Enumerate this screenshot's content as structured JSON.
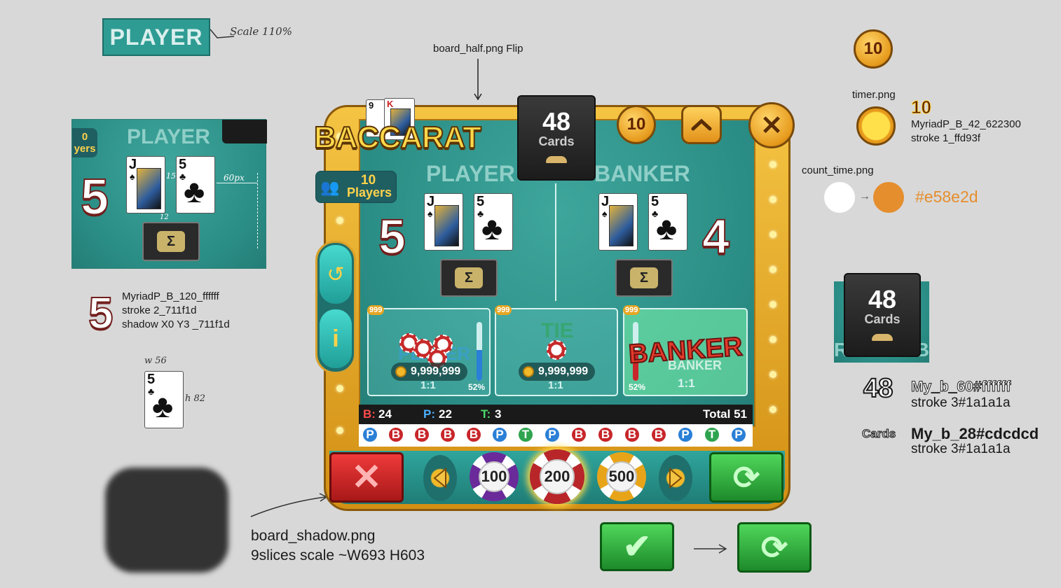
{
  "colors": {
    "felt": "#2a8d85",
    "gold": "#e5a623",
    "red": "#c8262a",
    "green": "#2ea44f",
    "count_orange": "#e58e2d",
    "panel_dark": "#1a1a1a"
  },
  "annotations": {
    "player_tag": "PLAYER",
    "scale_note": "Scale 110%",
    "board_half": "board_half.png  Flip",
    "timer_png": "timer.png",
    "timer_value": "10",
    "timer_font_line1": "MyriadP_B_42_622300",
    "timer_font_line2": "stroke 1_ffd93f",
    "count_time": "count_time.png",
    "count_color": "#e58e2d",
    "score_font_line1": "MyriadP_B_120_ffffff",
    "score_font_line2": "stroke 2_711f1d",
    "score_font_line3": "shadow X0 Y3 _711f1d",
    "w_note": "w 56",
    "h_note": "h 82",
    "shadow_line1": "board_shadow.png",
    "shadow_line2": "9slices scale ~W693 H603",
    "cards_num_font": "My_b_60#ffffff",
    "cards_num_stroke": "stroke 3#1a1a1a",
    "cards_lbl_font": "My_b_28#cdcdcd",
    "cards_lbl_stroke": "stroke 3#1a1a1a",
    "demo_num": "48",
    "demo_lbl": "Cards",
    "gap_15": "15",
    "gap_60": "60px",
    "gap_12": "12"
  },
  "zoom_panel": {
    "title": "PLAYER",
    "players_num": "0",
    "players_lbl": "yers",
    "score": "5",
    "card1": "J",
    "card2": "5"
  },
  "sample_score": "5",
  "sample_card": "5",
  "game": {
    "logo": "BACCARAT",
    "players_count": "10",
    "players_label": "Players",
    "cards_count": "48",
    "cards_label": "Cards",
    "timer": "10",
    "player_label": "PLAYER",
    "banker_label": "BANKER",
    "player_score": "5",
    "banker_score": "4",
    "player_cards": [
      "J",
      "5"
    ],
    "banker_cards": [
      "J",
      "5"
    ],
    "bets": [
      {
        "name": "PLAYER",
        "amount": "9,999,999",
        "odds": "1:1",
        "percent": "52%",
        "max": "999"
      },
      {
        "name": "TIE",
        "amount": "9,999,999",
        "odds": "1:1",
        "max": "999"
      },
      {
        "name": "BANKER",
        "amount": "",
        "odds": "1:1",
        "percent": "52%",
        "max": "999",
        "win_text": "BANKER"
      }
    ],
    "stats": {
      "b_label": "B:",
      "b": "24",
      "p_label": "P:",
      "p": "22",
      "t_label": "T:",
      "t": "3",
      "total": "Total 51"
    },
    "history": [
      "P",
      "B",
      "B",
      "B",
      "B",
      "P",
      "T",
      "P",
      "B",
      "B",
      "B",
      "B",
      "P",
      "T",
      "P"
    ],
    "chips": [
      "100",
      "200",
      "500"
    ],
    "chip_stack_label": "200"
  },
  "side_cards_box": {
    "count": "48",
    "label": "Cards",
    "bg_left": "R",
    "bg_right": "B"
  }
}
